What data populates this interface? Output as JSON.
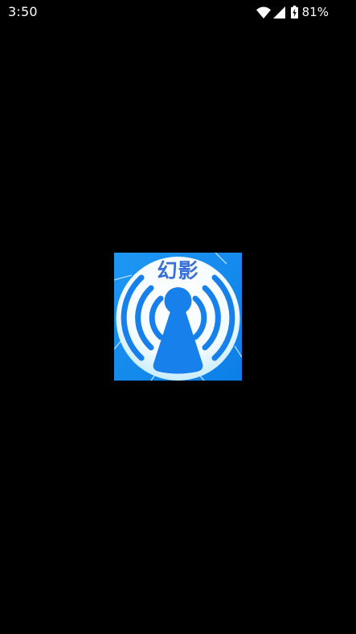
{
  "status_bar": {
    "time": "3:50",
    "battery_percent": "81%",
    "icons": [
      "wifi-icon",
      "cellular-signal-icon",
      "battery-charging-icon"
    ]
  },
  "splash": {
    "logo_text": "幻影",
    "logo_icon": "wifi-antenna-icon",
    "colors": {
      "background": "#000000",
      "logo_blue": "#1a8cf0",
      "logo_text": "#3a6fd6"
    }
  }
}
